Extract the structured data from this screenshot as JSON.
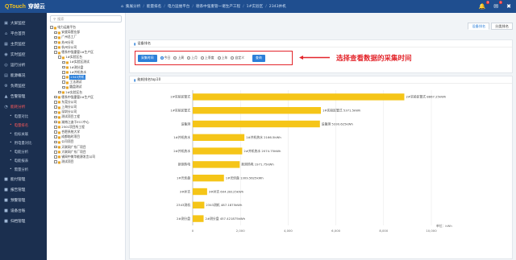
{
  "app": {
    "logo_q": "QTouch",
    "logo_name": "穿越云"
  },
  "breadcrumb": [
    "集展分析",
    "能量排名",
    "电力运维平台",
    "德系中强重管一诸生产工程",
    "1#实验区",
    "2343并机"
  ],
  "top_icons": {
    "bell_count": "3",
    "mail_count": "1"
  },
  "nav": [
    {
      "icon": "monitor",
      "label": "大屏监控"
    },
    {
      "icon": "home",
      "label": "平台首页"
    },
    {
      "icon": "grid",
      "label": "主页监控"
    },
    {
      "icon": "pin",
      "label": "实时监控"
    },
    {
      "icon": "globe",
      "label": "运行分析"
    },
    {
      "icon": "chart",
      "label": "能源概况"
    },
    {
      "icon": "settings",
      "label": "负荷监控"
    },
    {
      "icon": "bell",
      "label": "告警管理"
    },
    {
      "icon": "analysis",
      "label": "能耗分析"
    }
  ],
  "nav_sub": [
    "电量对比",
    "电量排名",
    "指标关联",
    "用电量对比",
    "电能分析",
    "电能报表",
    "需量分析"
  ],
  "nav_bottom": [
    "能付管理",
    "报告管理",
    "预警管理",
    "设备台账",
    "归档管理"
  ],
  "tree": {
    "search_placeholder": "搜索",
    "nodes": [
      {
        "d": 0,
        "t": "电力运维平台"
      },
      {
        "d": 1,
        "t": "安度局营业部"
      },
      {
        "d": 1,
        "t": "广州总工厂"
      },
      {
        "d": 1,
        "t": "苏州分司"
      },
      {
        "d": 1,
        "t": "杭州分公司"
      },
      {
        "d": 1,
        "t": "德系中强重管1#生产区"
      },
      {
        "d": 2,
        "t": "1#实验区台"
      },
      {
        "d": 3,
        "t": "1#实验区测试"
      },
      {
        "d": 3,
        "t": "1#测分盘"
      },
      {
        "d": 3,
        "t": "1#并机热水"
      },
      {
        "d": 3,
        "t": "2343并机",
        "sel": true
      },
      {
        "d": 3,
        "t": "工法测试"
      },
      {
        "d": 3,
        "t": "圆盘测试"
      },
      {
        "d": 2,
        "t": "2#实验区台"
      },
      {
        "d": 1,
        "t": "德系中强重管2#生产区"
      },
      {
        "d": 1,
        "t": "东莞分公司"
      },
      {
        "d": 1,
        "t": "上海分公司"
      },
      {
        "d": 1,
        "t": "深圳分公司"
      },
      {
        "d": 1,
        "t": "测试项目工程"
      },
      {
        "d": 1,
        "t": "湖南江造干ECC中心"
      },
      {
        "d": 1,
        "t": "2501项目所工程"
      },
      {
        "d": 1,
        "t": "合肥系统大学"
      },
      {
        "d": 1,
        "t": "成都临时项目"
      },
      {
        "d": 1,
        "t": "公司项目"
      },
      {
        "d": 1,
        "t": "天联网广东厂项目"
      },
      {
        "d": 1,
        "t": "大联网广东厂项目"
      },
      {
        "d": 1,
        "t": "锡网中美华能源发言公司"
      },
      {
        "d": 1,
        "t": "测试项目"
      }
    ]
  },
  "tabs": [
    "设备排名",
    "分类排名"
  ],
  "filter": {
    "title": "设备排名",
    "button": "采集时间",
    "options": [
      "今日",
      "上周",
      "上月",
      "上季度",
      "上年",
      "自定义"
    ],
    "selected": 0,
    "query": "查询"
  },
  "annotation": "选择查看数据的采集时间",
  "chart_title": "能耗排名top10",
  "colors": {
    "bar": "#f5c518",
    "accent": "#2b7fd9",
    "highlight": "#e3262c",
    "nav_bg": "#1b2f4f",
    "top_bg": "#1f4e8f"
  },
  "chart_data": {
    "type": "bar",
    "orientation": "horizontal",
    "categories": [
      "2#实验区管式",
      "1#实验区管式",
      "设备测",
      "1#并机热水",
      "2#并机热水",
      "新测热电",
      "1#光伏盘",
      "3#并吉",
      "2343测机",
      "2#测分盘"
    ],
    "values": [
      8867.25,
      5371.5,
      5330.625,
      2166.5,
      2074.75,
      1971.75,
      1309.5625,
      604.28125,
      487.1875,
      457.421875
    ],
    "labels": [
      "2#实验区管式 8867.25kWh",
      "1#实验区管式 5371.5kWh",
      "设备测 5330.625kWh",
      "1#并机热水 2166.5kWh",
      "2#并机热水 2074.75kWh",
      "新测热电 1971.75kWh",
      "1#光伏盘 1309.5625kWh",
      "3#并吉 604.28125kWh",
      "2343测机 487.1875kWh",
      "2#测分盘 457.421875kWh"
    ],
    "xticks": [
      "0",
      "2,000",
      "4,000",
      "6,000",
      "8,000",
      "10,000"
    ],
    "xlim": [
      0,
      10000
    ],
    "unit": "单位：kWh"
  }
}
